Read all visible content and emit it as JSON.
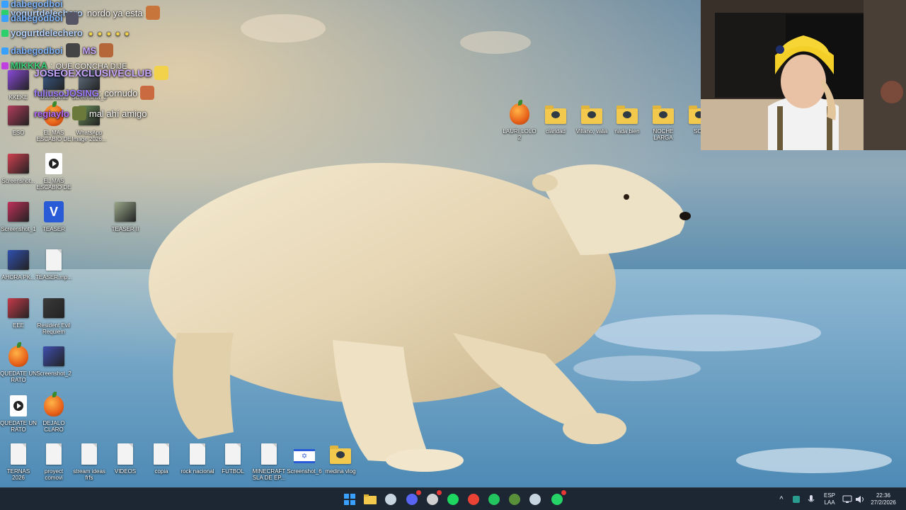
{
  "chat": {
    "messages": [
      {
        "user": "dabegodboi",
        "text": "",
        "user_color": "#7fb6ff"
      },
      {
        "user": "yogurtdelechero",
        "text": "nordo ya esta",
        "user_color": "#b6d4ff"
      },
      {
        "user": "dabegodboi",
        "text": "",
        "user_color": "#7fb6ff"
      },
      {
        "user": "yogurtdelechero",
        "text": "",
        "user_color": "#b6d4ff"
      },
      {
        "user": "dabegodboi",
        "text": "MS",
        "user_color": "#7fb6ff"
      },
      {
        "user": "MIKKKA",
        "text": "QUE CONCHA DIJE",
        "user_color": "#3ad07a"
      },
      {
        "user": "JOSEOEXCLUSIVECLUB",
        "text": "",
        "user_color": "#c9a7ff"
      },
      {
        "user": "fuliusoJOSING",
        "text": "cornudo",
        "user_color": "#9a7cff"
      },
      {
        "user": "regiaylo",
        "text": "mal ahí amigo",
        "user_color": "#b26bff"
      }
    ]
  },
  "desktop": {
    "icons": [
      {
        "label": "KKEKE",
        "kind": "thumb",
        "color": "#8a4ad8"
      },
      {
        "label": "locos.canal",
        "kind": "thumb",
        "color": "#3b5e8f"
      },
      {
        "label": "Screenshot_3",
        "kind": "thumb",
        "color": "#667788"
      },
      {
        "label": "ESO",
        "kind": "thumb",
        "color": "#b33c5c"
      },
      {
        "label": "EL MAS ESCABIO DE",
        "kind": "fruit"
      },
      {
        "label": "WhatsApp Image 2026...",
        "kind": "thumb",
        "color": "#6b8f5a"
      },
      {
        "label": "Screenshot...",
        "kind": "thumb",
        "color": "#d04050"
      },
      {
        "label": "EL MAS ESCABIO DE",
        "kind": "play"
      },
      {
        "label": "Screenshot_1",
        "kind": "thumb",
        "color": "#c0305a"
      },
      {
        "label": "TEASER",
        "kind": "v"
      },
      {
        "label": "TEASER II",
        "kind": "thumb",
        "color": "#9aa88a"
      },
      {
        "label": "AHORA PK...",
        "kind": "thumb",
        "color": "#3050b0"
      },
      {
        "label": "TEASER.mp...",
        "kind": "doc"
      },
      {
        "label": "EEE",
        "kind": "thumb",
        "color": "#c63b4a"
      },
      {
        "label": "Resident Evil Requiem",
        "kind": "thumb",
        "color": "#3a3a3a"
      },
      {
        "label": "QUEDATE UN RATO",
        "kind": "fruit"
      },
      {
        "label": "Screenshot_2",
        "kind": "thumb",
        "color": "#3f4fb0"
      },
      {
        "label": "QUEDATE UN RATO",
        "kind": "play"
      },
      {
        "label": "DEJALO CLARO",
        "kind": "fruit"
      },
      {
        "label": "TERNAS 2026",
        "kind": "doc"
      },
      {
        "label": "proyect comovi",
        "kind": "doc"
      },
      {
        "label": "stream ideas frfs",
        "kind": "doc"
      },
      {
        "label": "VIDEOS",
        "kind": "doc"
      },
      {
        "label": "copia",
        "kind": "doc"
      },
      {
        "label": "rock nacional",
        "kind": "doc"
      },
      {
        "label": "FUTBOL",
        "kind": "doc"
      },
      {
        "label": "MINECRAFT SLA DE EP...",
        "kind": "doc"
      },
      {
        "label": "Screenshot_6",
        "kind": "flag"
      },
      {
        "label": "medina vlog",
        "kind": "folder"
      },
      {
        "label": "LAURI LOLO 2",
        "kind": "fruit"
      },
      {
        "label": "claridad",
        "kind": "folder"
      },
      {
        "label": "Villano, valia",
        "kind": "folder"
      },
      {
        "label": "nada bien",
        "kind": "folder"
      },
      {
        "label": "NOCHE LARGA",
        "kind": "folder"
      },
      {
        "label": "SOL",
        "kind": "folder"
      }
    ]
  },
  "taskbar": {
    "apps": [
      {
        "name": "start-icon",
        "color": "#3aa0ff"
      },
      {
        "name": "file-explorer-icon",
        "color": "#f2c94c"
      },
      {
        "name": "steam-icon",
        "color": "#c7d5e0"
      },
      {
        "name": "discord-icon",
        "color": "#5865f2"
      },
      {
        "name": "obs-icon",
        "color": "#d0d0d0"
      },
      {
        "name": "spotify-icon",
        "color": "#1ed760"
      },
      {
        "name": "chrome-icon",
        "color": "#ea4335"
      },
      {
        "name": "capcut-icon",
        "color": "#22c55e"
      },
      {
        "name": "minecraft-icon",
        "color": "#5a8f3a"
      },
      {
        "name": "steam-icon-2",
        "color": "#c7d5e0"
      },
      {
        "name": "whatsapp-icon",
        "color": "#25d366"
      }
    ],
    "chevron": "^",
    "lang_top": "ESP",
    "lang_bottom": "LAA",
    "time": "22:36",
    "date": "27/2/2026"
  }
}
